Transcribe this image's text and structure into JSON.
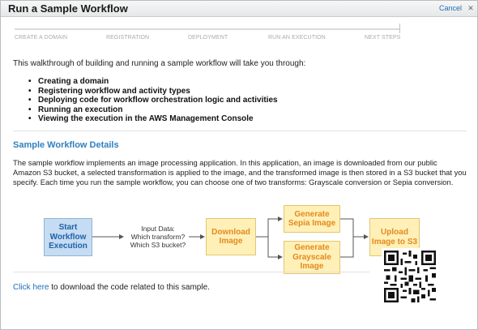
{
  "dialog": {
    "title": "Run a Sample Workflow",
    "cancel_label": "Cancel",
    "close_glyph": "✕"
  },
  "steps": [
    {
      "label": "CREATE A DOMAIN"
    },
    {
      "label": "REGISTRATION"
    },
    {
      "label": "DEPLOYMENT"
    },
    {
      "label": "RUN AN EXECUTION"
    },
    {
      "label": "NEXT STEPS"
    }
  ],
  "intro": {
    "text": "This walkthrough of building and running a sample workflow will take you through:",
    "bullets": [
      "Creating a domain",
      "Registering workflow and activity types",
      "Deploying code for workflow orchestration logic and activities",
      "Running an execution",
      "Viewing the execution in the AWS Management Console"
    ]
  },
  "details": {
    "title": "Sample Workflow Details",
    "description": "The sample workflow implements an image processing application. In this application, an image is downloaded from our public Amazon S3 bucket, a selected transformation is applied to the image, and the transformed image is then stored in a S3 bucket that you specify. Each time you run the sample workflow, you can choose one of two transforms: Grayscale conversion or Sepia conversion."
  },
  "diagram": {
    "start": "Start Workflow Execution",
    "input_line1": "Input Data:",
    "input_line2": "Which transform?",
    "input_line3": "Which S3 bucket?",
    "download": "Download Image",
    "sepia": "Generate Sepia Image",
    "grayscale": "Generate Grayscale Image",
    "upload": "Upload Image to S3"
  },
  "footer": {
    "link_text": "Click here",
    "rest_text": " to download the code related to this sample."
  },
  "colors": {
    "accent": "#2f80c0",
    "link": "#1e6fb8",
    "start_box": "#c6dcf2",
    "activity_box": "#fff0b8",
    "activity_text": "#e38a1e"
  }
}
